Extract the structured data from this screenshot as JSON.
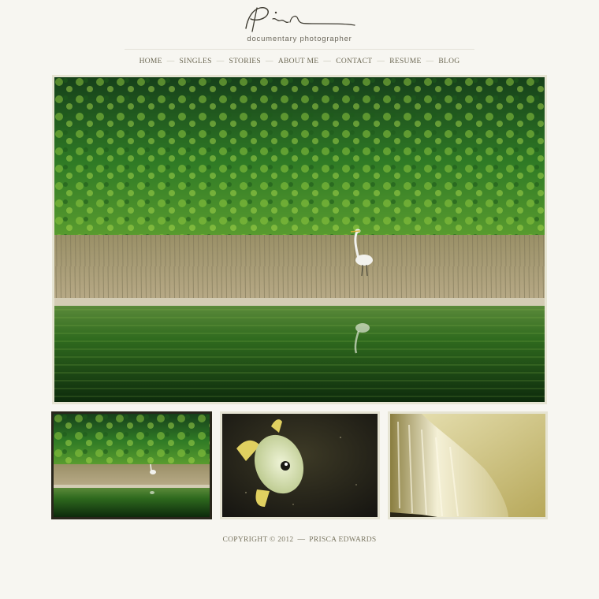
{
  "header": {
    "tagline": "documentary photographer"
  },
  "nav": {
    "items": [
      "HOME",
      "SINGLES",
      "STORIES",
      "ABOUT ME",
      "CONTACT",
      "RESUME",
      "BLOG"
    ],
    "separator": "—"
  },
  "gallery": {
    "thumbnails": [
      {
        "subject": "heron-in-marsh",
        "selected": true
      },
      {
        "subject": "fish-underwater",
        "selected": false
      },
      {
        "subject": "waterfall",
        "selected": false
      }
    ]
  },
  "footer": {
    "copyright": "COPYRIGHT © 2012",
    "dash": "—",
    "name": "PRISCA EDWARDS"
  },
  "colors": {
    "background": "#f7f6f1",
    "frame": "#e6e4d3",
    "selected_frame": "#29261c",
    "text": "#6c6853"
  }
}
